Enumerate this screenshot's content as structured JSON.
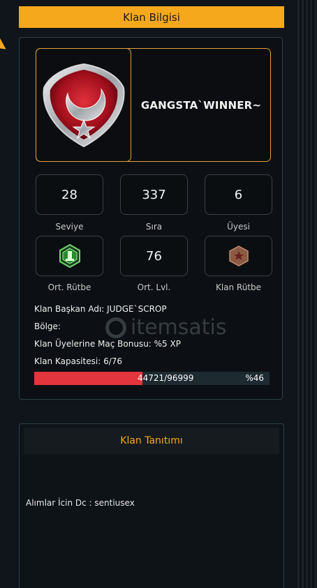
{
  "header": {
    "title": "Klan Bilgisi"
  },
  "clan": {
    "name": "GANGSTA`WINNER~",
    "emblem_icon": "crescent-star-shield-icon"
  },
  "stats": [
    {
      "value": "28",
      "label": "Seviye"
    },
    {
      "value": "337",
      "label": "Sıra"
    },
    {
      "value": "6",
      "label": "Üyesi"
    },
    {
      "value": "",
      "label": "Ort. Rütbe",
      "icon": "green-rank-badge-icon"
    },
    {
      "value": "76",
      "label": "Ort. Lvl."
    },
    {
      "value": "",
      "label": "Klan Rütbe",
      "icon": "bronze-star-hexagon-icon"
    }
  ],
  "info": {
    "leader": "Klan Başkan Adı: JUDGE`SCROP",
    "region": "Bölge:",
    "bonus": "Klan Üyelerine Maç Bonusu: %5 XP",
    "capacity": "Klan Kapasitesi: 6/76"
  },
  "progress": {
    "text": "44721/96999",
    "percent_label": "%46",
    "fraction": 0.46
  },
  "watermark": {
    "text": "itemsatis"
  },
  "intro": {
    "title": "Klan Tanıtımı",
    "text": "Alımlar İcin Dc : sentiusex"
  },
  "colors": {
    "accent": "#f6a81c",
    "progress_fill": "#e3353d",
    "panel_border": "#2e4045"
  }
}
